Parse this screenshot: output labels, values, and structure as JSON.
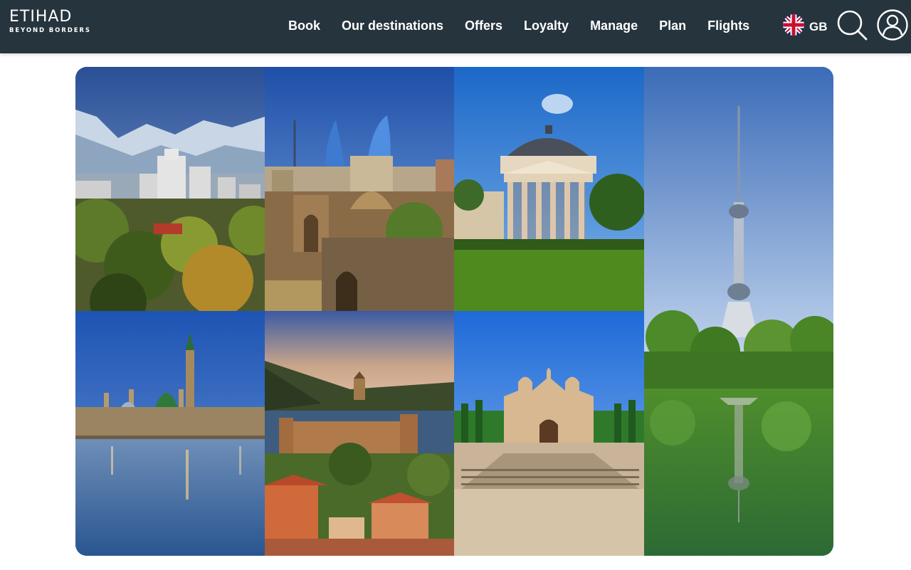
{
  "brand": {
    "name": "ETIHAD",
    "tagline": "BEYOND BORDERS"
  },
  "nav": {
    "items": [
      {
        "label": "Book"
      },
      {
        "label": "Our destinations"
      },
      {
        "label": "Offers"
      },
      {
        "label": "Loyalty"
      },
      {
        "label": "Manage"
      },
      {
        "label": "Plan"
      },
      {
        "label": "Flights"
      }
    ]
  },
  "language": {
    "code": "GB",
    "flag_icon": "uk-flag-icon"
  },
  "icons": {
    "search": "search-icon",
    "profile": "user-profile-icon"
  },
  "colors": {
    "header_bg": "#25343d",
    "header_text": "#ffffff",
    "page_bg": "#ffffff"
  }
}
